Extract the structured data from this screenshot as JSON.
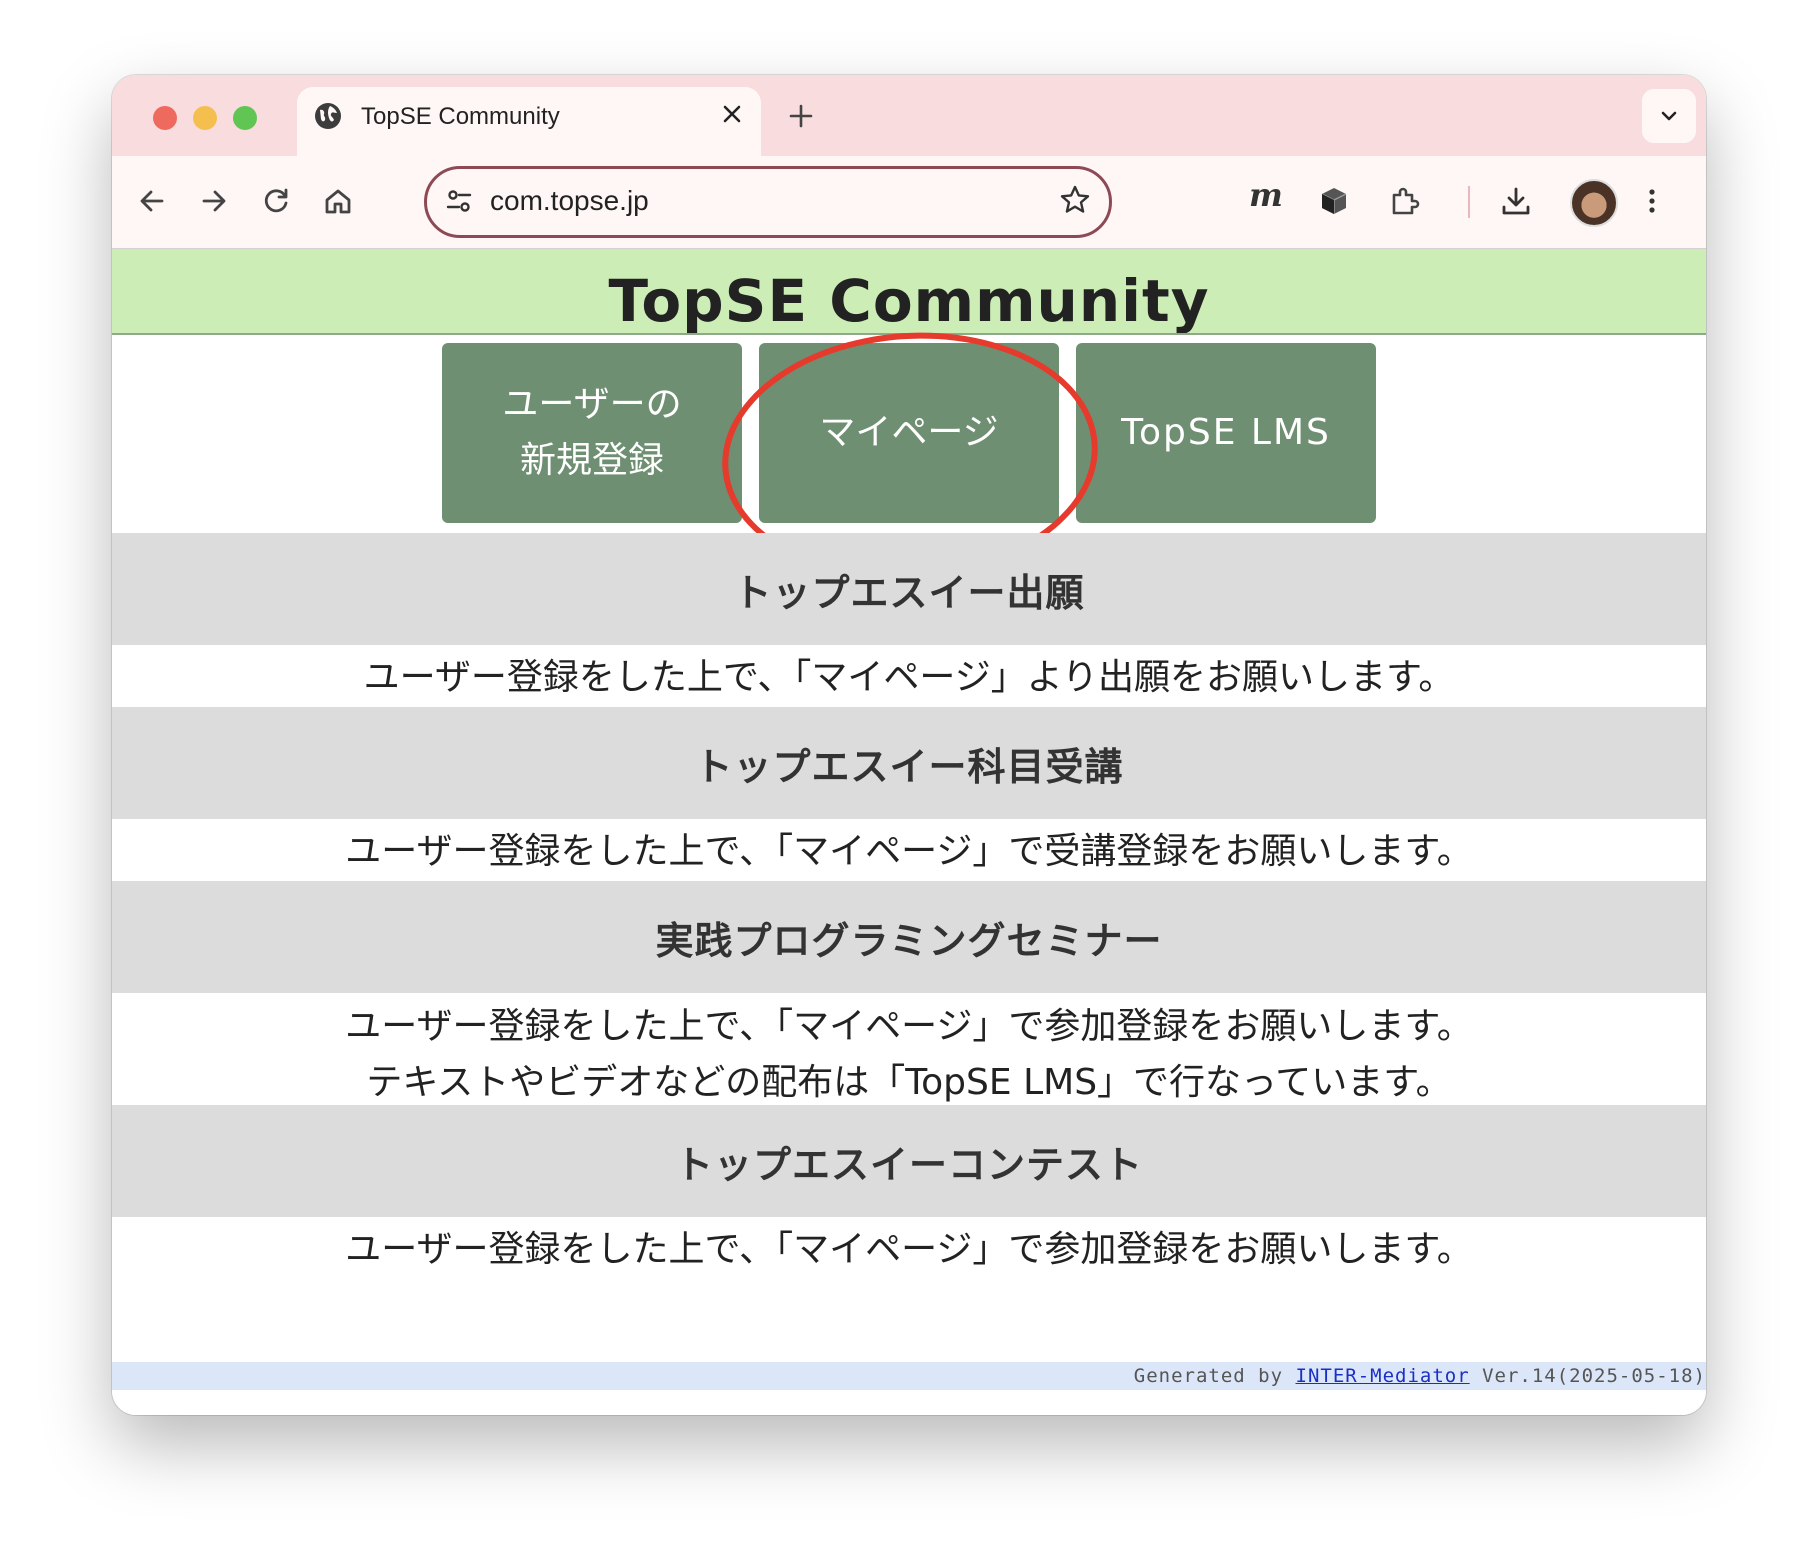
{
  "browser": {
    "tab": {
      "title": "TopSE Community",
      "icon": "globe-icon"
    },
    "address": {
      "url": "com.topse.jp"
    },
    "extensions": {
      "m_label": "m"
    }
  },
  "site": {
    "title": "TopSE Community",
    "nav": [
      {
        "lines": [
          "ユーザーの",
          "新規登録"
        ]
      },
      {
        "label": "マイページ"
      },
      {
        "label": "TopSE LMS"
      }
    ]
  },
  "sections": [
    {
      "heading": "トップエスイー出願",
      "lines": [
        "ユーザー登録をした上で、「マイページ」より出願をお願いします。"
      ]
    },
    {
      "heading": "トップエスイー科目受講",
      "lines": [
        "ユーザー登録をした上で、「マイページ」で受講登録をお願いします。"
      ]
    },
    {
      "heading": "実践プログラミングセミナー",
      "lines": [
        "ユーザー登録をした上で、「マイページ」で参加登録をお願いします。",
        "テキストやビデオなどの配布は「TopSE LMS」で行なっています。"
      ]
    },
    {
      "heading": "トップエスイーコンテスト",
      "lines": [
        "ユーザー登録をした上で、「マイページ」で参加登録をお願いします。"
      ]
    }
  ],
  "footer": {
    "prefix": "Generated by ",
    "link": "INTER-Mediator",
    "suffix": " Ver.14(2025-05-18)"
  },
  "colors": {
    "header_bg": "#ccedb5",
    "button_bg": "#6f8f72",
    "section_head_bg": "#dcdcdc",
    "annotation": "#e53a2c"
  }
}
